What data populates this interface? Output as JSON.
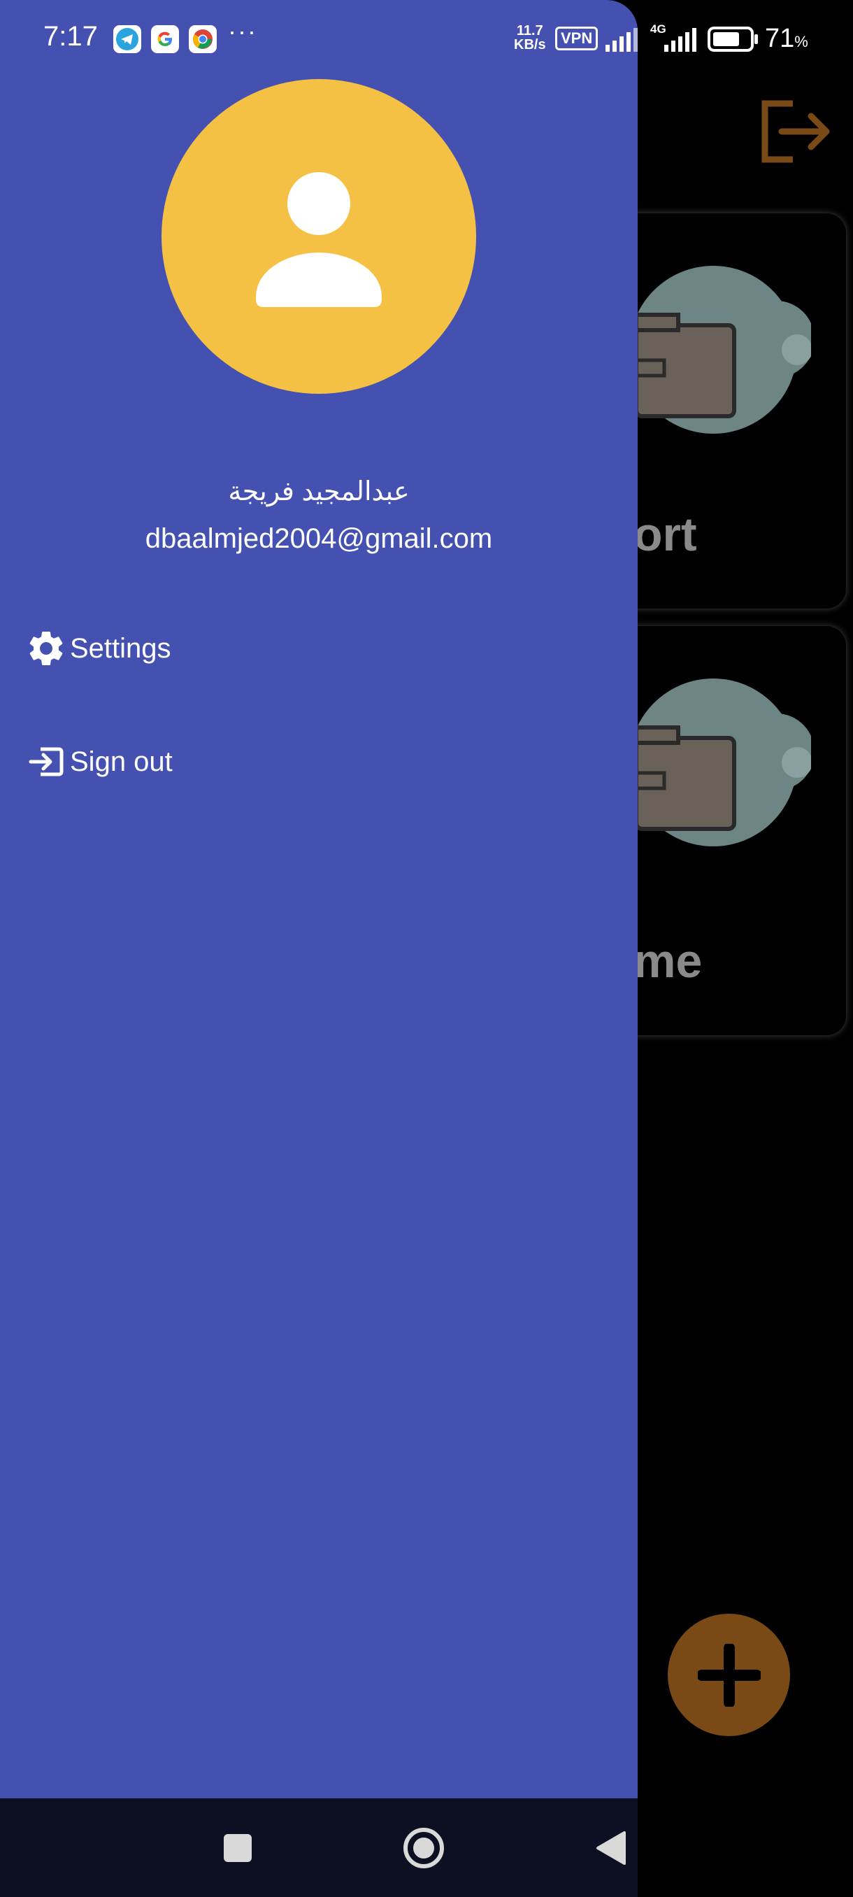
{
  "status_bar": {
    "time": "7:17",
    "net_speed_value": "11.7",
    "net_speed_unit": "KB/s",
    "vpn": "VPN",
    "network": "4G",
    "battery_percent": "71",
    "battery_unit": "%",
    "more": "···"
  },
  "drawer": {
    "user_name": "عبدالمجيد فريجة",
    "user_email": "dbaalmjed2004@gmail.com",
    "menu": [
      {
        "label": "Settings",
        "icon": "gear-icon"
      },
      {
        "label": "Sign out",
        "icon": "sign-out-icon"
      }
    ]
  },
  "background": {
    "cards": [
      {
        "label": "ort"
      },
      {
        "label": "me"
      }
    ]
  },
  "colors": {
    "drawer_bg": "#4551b1",
    "avatar_bg": "#f4c144",
    "accent": "#7a4a16",
    "navbar_bg": "#0d1022"
  }
}
